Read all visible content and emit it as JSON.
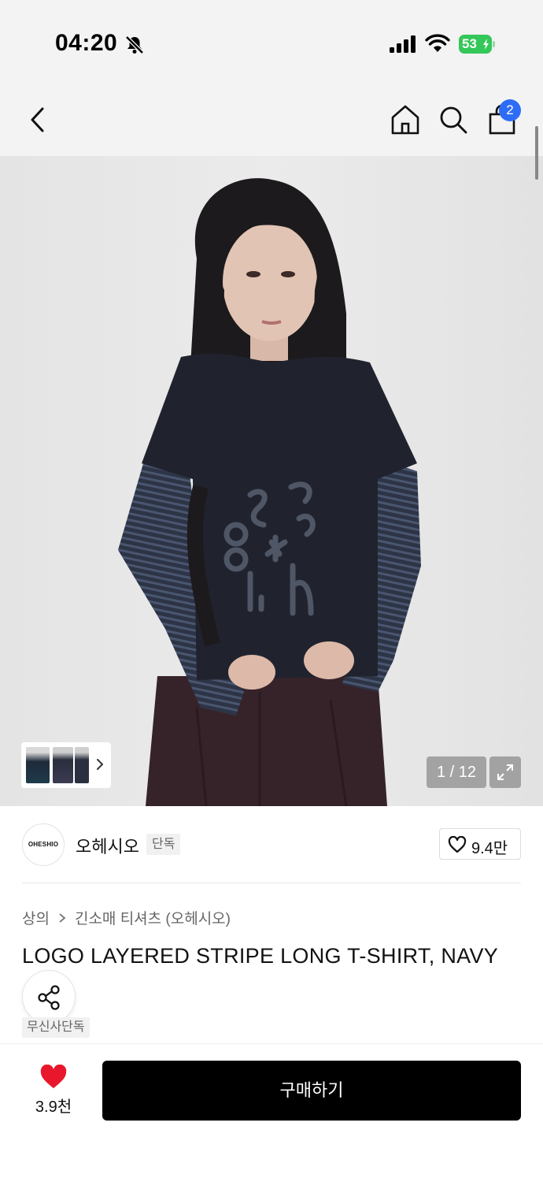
{
  "status_bar": {
    "time": "04:20",
    "battery_level": "53",
    "icons": [
      "bell-slash-icon",
      "cellular-signal-icon",
      "wifi-icon",
      "battery-charging-icon"
    ]
  },
  "nav": {
    "icons": [
      "chevron-left-icon",
      "home-icon",
      "search-icon",
      "shopping-bag-icon"
    ],
    "cart_count": "2"
  },
  "gallery": {
    "counter": "1 / 12",
    "current": 1,
    "total": 12,
    "logo_print": "ohesh*io"
  },
  "brand": {
    "logo_text": "OHESHIO",
    "name": "오헤시오",
    "exclusive_tag": "단독",
    "likes": "9.4만"
  },
  "product": {
    "breadcrumb": [
      "상의",
      "긴소매 티셔츠 (오헤시오)"
    ],
    "title": "LOGO LAYERED STRIPE LONG T-SHIRT, NAVY",
    "tag": "무신사단독"
  },
  "bottom": {
    "wish_count": "3.9천",
    "buy_label": "구매하기"
  },
  "colors": {
    "status_bg": "#f3f3f3",
    "badge_blue": "#2d6cf6",
    "battery_green": "#34c759",
    "heart_red": "#e8172b",
    "buy_button": "#000000"
  }
}
